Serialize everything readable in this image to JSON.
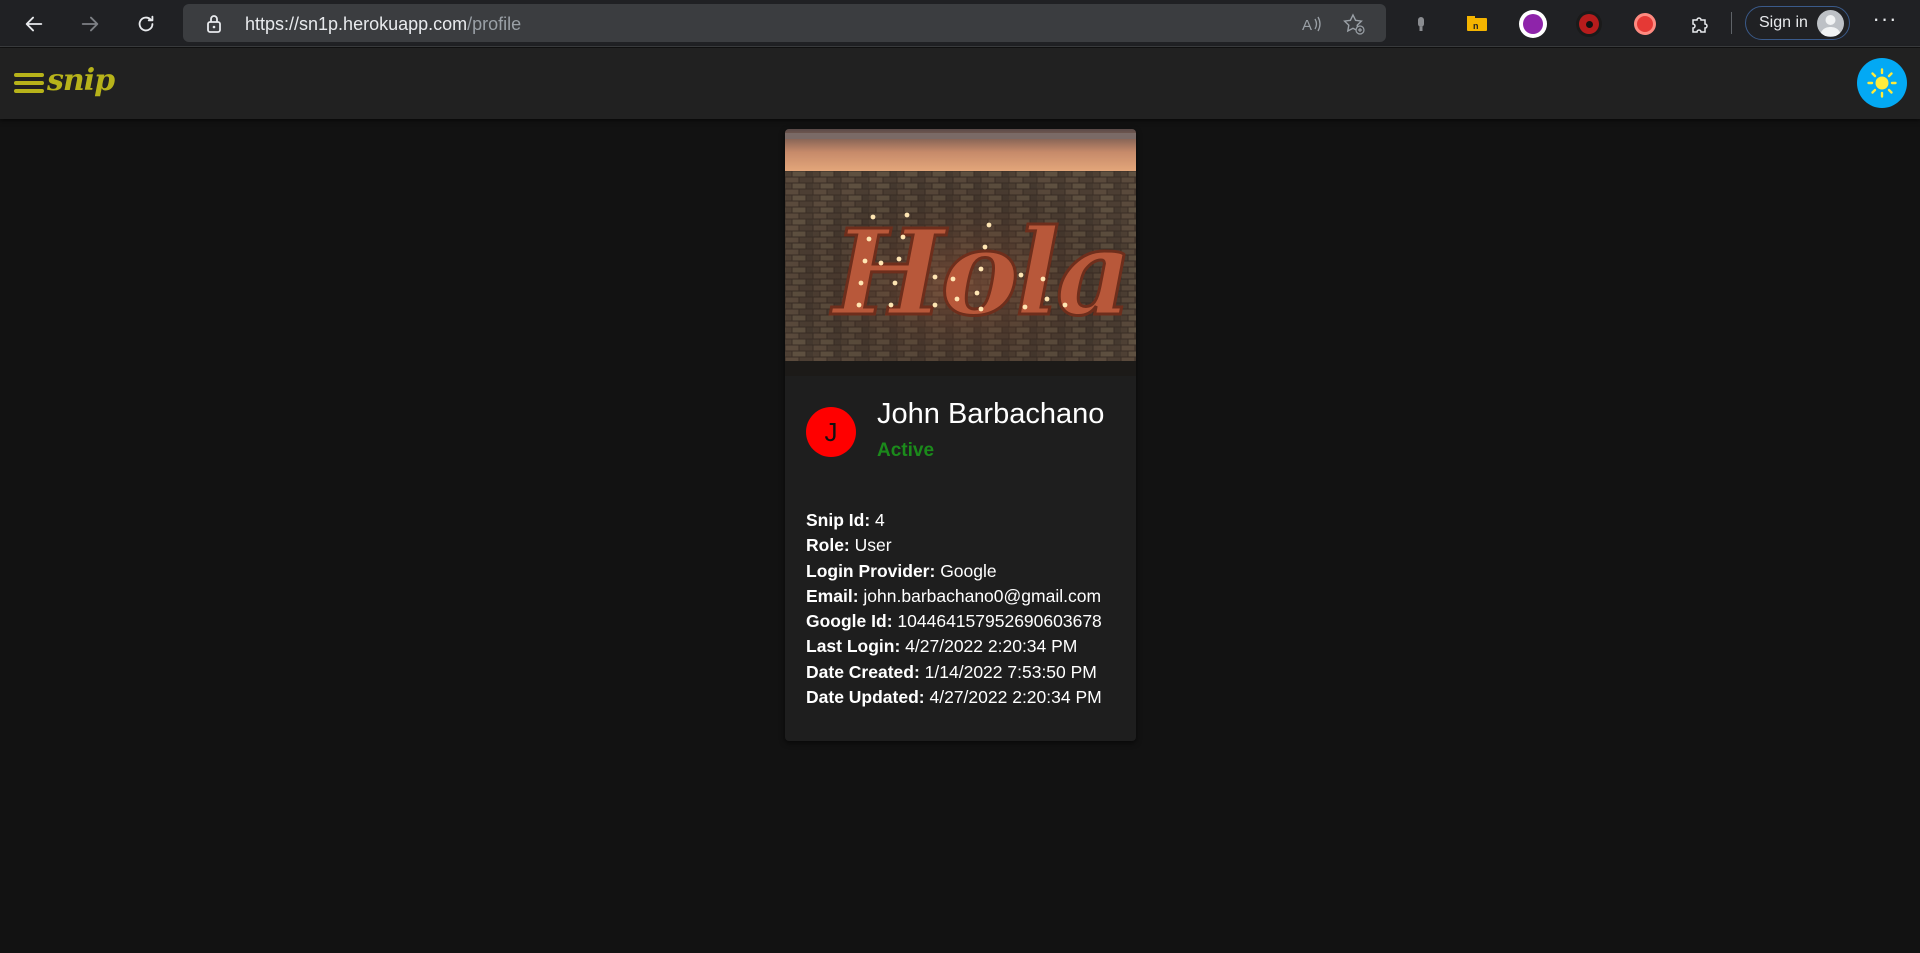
{
  "browser": {
    "url_host": "https://sn1p.herokuapp.com",
    "url_path": "/profile",
    "signin_label": "Sign in",
    "more_label": "···"
  },
  "app": {
    "logo_text": "snip",
    "accent_color": "#b7b31a",
    "theme_button_color": "#03a9f4"
  },
  "profile": {
    "banner_text": "Hola",
    "avatar_letter": "J",
    "avatar_color": "#ff0000",
    "name": "John Barbachano",
    "status": "Active",
    "status_color": "#1b8a1b",
    "fields": [
      {
        "label": "Snip Id:",
        "value": "4"
      },
      {
        "label": "Role:",
        "value": "User"
      },
      {
        "label": "Login Provider:",
        "value": "Google"
      },
      {
        "label": "Email:",
        "value": "john.barbachano0@gmail.com"
      },
      {
        "label": "Google Id:",
        "value": "104464157952690603678"
      },
      {
        "label": "Last Login:",
        "value": "4/27/2022 2:20:34 PM"
      },
      {
        "label": "Date Created:",
        "value": "1/14/2022 7:53:50 PM"
      },
      {
        "label": "Date Updated:",
        "value": "4/27/2022 2:20:34 PM"
      }
    ]
  }
}
